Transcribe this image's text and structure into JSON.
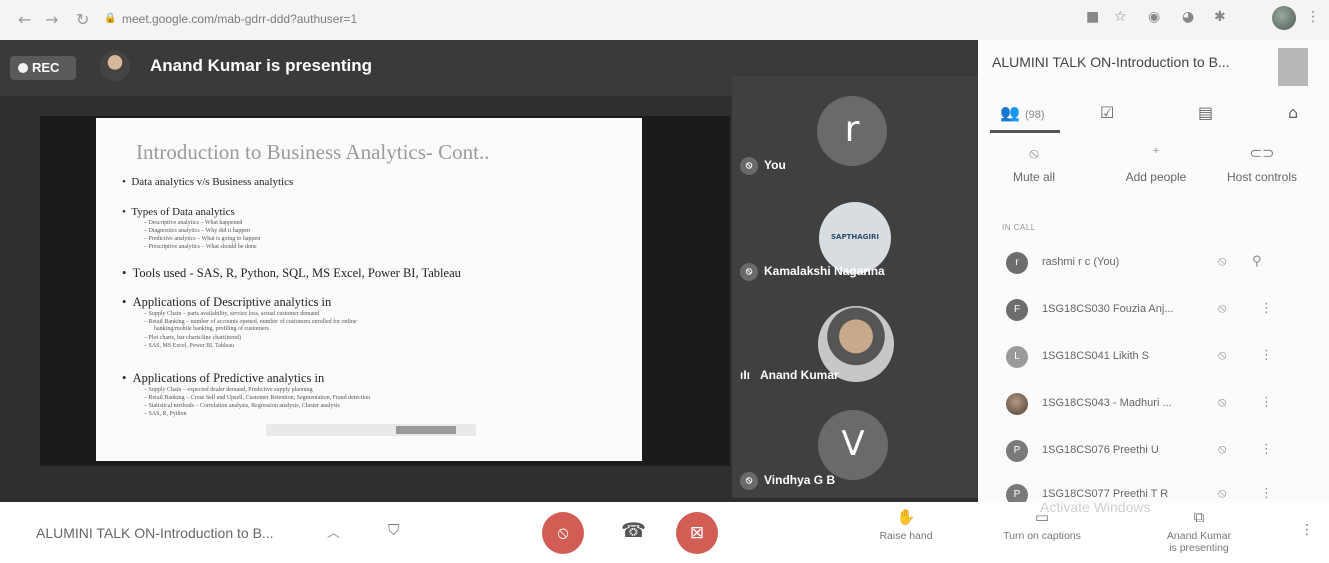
{
  "browser": {
    "url": "meet.google.com/mab-gdrr-ddd?authuser=1",
    "nav_icons": [
      "back-arrow",
      "forward-arrow",
      "reload"
    ],
    "toolbar_icons": [
      "camera-icon",
      "star-icon",
      "extension-icon",
      "extension-icon-2",
      "puzzle-icon",
      "profile-avatar",
      "menu-dots"
    ]
  },
  "meeting": {
    "rec_label": "REC",
    "presenting_text": "Anand Kumar is presenting",
    "title": "ALUMINI TALK ON-Introduction to B...",
    "panel_title": "ALUMINI TALK ON-Introduction to B..."
  },
  "slide": {
    "title": "Introduction to Business Analytics- Cont..",
    "items": [
      "Data analytics v/s Business analytics",
      "Types of Data analytics",
      "Tools used - SAS, R, Python, SQL, MS Excel, Power BI, Tableau",
      "Applications of Descriptive analytics in",
      "Applications of Predictive analytics in"
    ],
    "sub_types": [
      "Descriptive analytics – What happened",
      "Diagnostics analytics – Why did it happen",
      "Predictive analytics – What is going to happen",
      "Prescriptive analytics – What should be done"
    ],
    "sub_descriptive": [
      "Supply Chain – parts availability, service loss, actual customer demand",
      "Retail Banking – number of accounts opened, number of customers enrolled for online",
      "banking/mobile banking, profiling of customers",
      "Plot charts, bar charts/line chart(trend)",
      "SAS, MS Excel, Power BI, Tableau"
    ],
    "sub_predictive": [
      "Supply Chain – expected dealer demand, Predictive supply planning",
      "Retail Banking – Cross Sell and Upsell, Customer Retention, Segmentation, Fraud detection",
      "Statistical methods – Correlation analysis, Regression analysis, Cluster analysis",
      "SAS, R, Python"
    ]
  },
  "tiles": [
    {
      "name": "You",
      "avatar_letter": "r",
      "color": "#6a6a6a"
    },
    {
      "name": "Kamalakshi Naganna",
      "avatar_text": "SAPTHAGIRI",
      "color": "#d8dde2"
    },
    {
      "name": "Anand Kumar",
      "color": "#c9c9c9"
    },
    {
      "name": "Vindhya G B",
      "avatar_letter": "V",
      "color": "#6a6a6a"
    }
  ],
  "panel": {
    "people_count": "(98)",
    "mute_all": "Mute all",
    "add_people": "Add people",
    "host_controls": "Host controls",
    "in_call": "IN CALL",
    "participants": [
      {
        "initial": "r",
        "name": "rashmi r c (You)",
        "color": "#6d6d6d"
      },
      {
        "initial": "F",
        "name": "1SG18CS030 Fouzia Anj...",
        "color": "#6d6d6d"
      },
      {
        "initial": "L",
        "name": "1SG18CS041 Likith S",
        "color": "#9a9a9a"
      },
      {
        "initial": "",
        "name": "1SG18CS043 - Madhuri ...",
        "color": "#5a4a40"
      },
      {
        "initial": "P",
        "name": "1SG18CS076 Preethi U",
        "color": "#7a7a7a"
      },
      {
        "initial": "P",
        "name": "1SG18CS077 Preethi T R",
        "color": "#7a7a7a"
      }
    ]
  },
  "bottom": {
    "raise_hand": "Raise hand",
    "captions": "Turn on captions",
    "presenting_line1": "Anand Kumar",
    "presenting_line2": "is presenting",
    "watermark": "Activate Windows"
  },
  "colors": {
    "accent_red": "#d25d55",
    "stage_bg": "#2f2f2f"
  }
}
